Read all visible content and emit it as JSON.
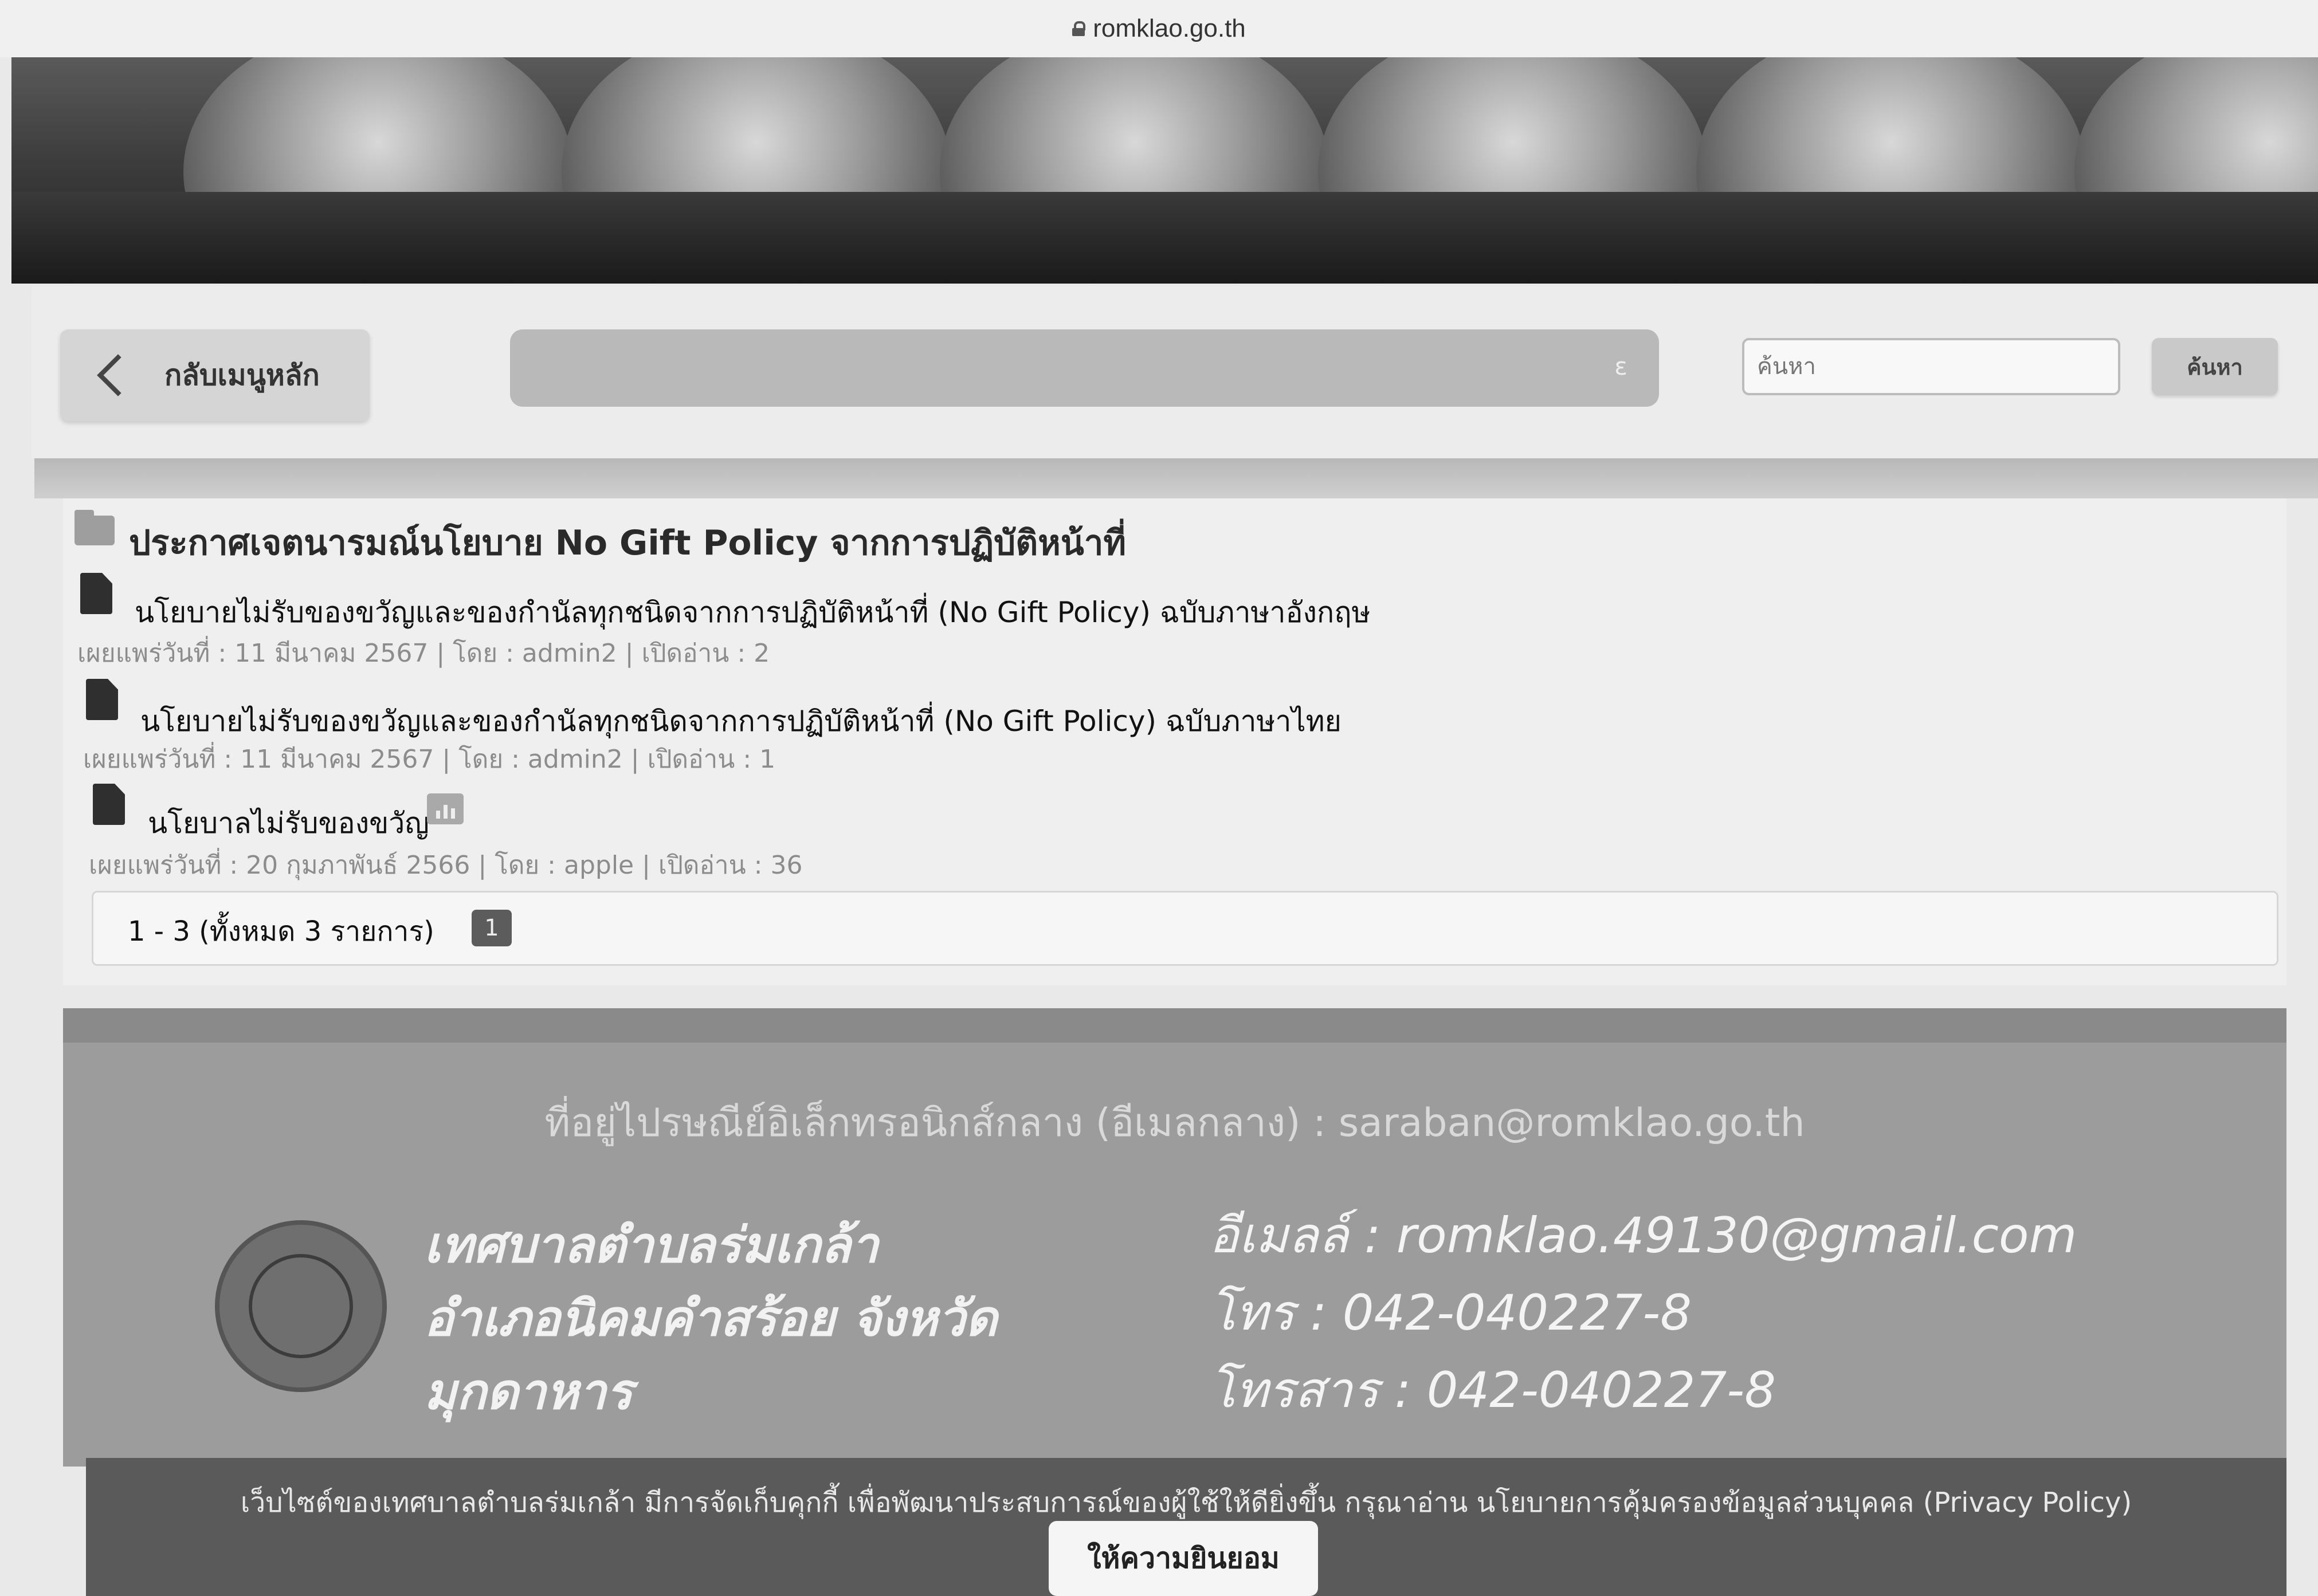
{
  "browser": {
    "url": "romklao.go.th"
  },
  "toolbar": {
    "back_label": "กลับเมนูหลัก",
    "marquee_text": "ε",
    "search_placeholder": "ค้นหา",
    "search_button": "ค้นหา"
  },
  "category": {
    "title": "ประกาศเจตนารมณ์นโยบาย No Gift Policy จากการปฏิบัติหน้าที่"
  },
  "items": [
    {
      "title": "นโยบายไม่รับของขวัญและของกำนัลทุกชนิดจากการปฏิบัติหน้าที่ (No Gift Policy) ฉบับภาษาอังกฤษ",
      "meta": "เผยแพร่วันที่ : 11 มีนาคม 2567 | โดย : admin2 | เปิดอ่าน : 2"
    },
    {
      "title": "นโยบายไม่รับของขวัญและของกำนัลทุกชนิดจากการปฏิบัติหน้าที่ (No Gift Policy) ฉบับภาษาไทย",
      "meta": "เผยแพร่วันที่ : 11 มีนาคม 2567 | โดย : admin2 | เปิดอ่าน : 1"
    },
    {
      "title": "นโยบาลไม่รับของขวัญ",
      "meta": "เผยแพร่วันที่ : 20 กุมภาพันธ์ 2566 | โดย : apple | เปิดอ่าน : 36"
    }
  ],
  "pagination": {
    "summary": "1 - 3 (ทั้งหมด 3 รายการ)",
    "current_page": "1"
  },
  "footer": {
    "central_email": "ที่อยู่ไปรษณีย์อิเล็กทรอนิกส์กลาง (อีเมลกลาง) : saraban@romklao.go.th",
    "org_line1": "เทศบาลตำบลร่มเกล้า",
    "org_line2": "อำเภอนิคมคำสร้อย จังหวัด",
    "org_line3": "มุกดาหาร",
    "email": "อีเมลล์ : romklao.49130@gmail.com",
    "phone": "โทร : 042-040227-8",
    "fax": "โทรสาร : 042-040227-8"
  },
  "cookie": {
    "text": "เว็บไซต์ของเทศบาลตำบลร่มเกล้า มีการจัดเก็บคุกกี้ เพื่อพัฒนาประสบการณ์ของผู้ใช้ให้ดียิ่งขึ้น กรุณาอ่าน นโยบายการคุ้มครองข้อมูลส่วนบุคคล (Privacy Policy)",
    "accept": "ให้ความยินยอม"
  }
}
